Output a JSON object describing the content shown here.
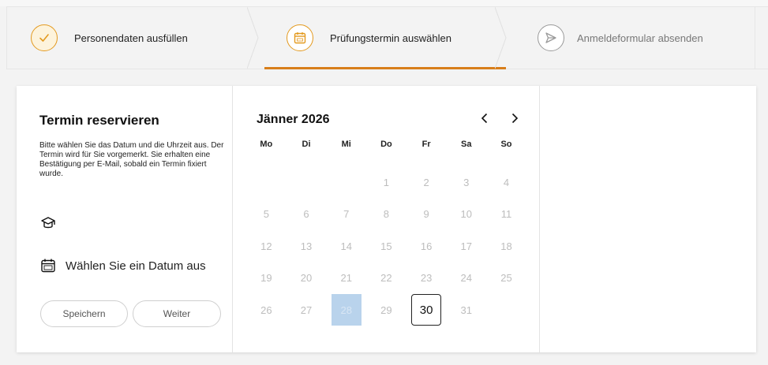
{
  "steps": [
    {
      "label": "Personendaten ausfüllen",
      "state": "done"
    },
    {
      "label": "Prüfungstermin auswählen",
      "state": "active"
    },
    {
      "label": "Anmeldeformular absenden",
      "state": "pending"
    }
  ],
  "reservation": {
    "title": "Termin reservieren",
    "description": "Bitte wählen Sie das Datum und die Uhrzeit aus. Der Termin wird für Sie vorgemerkt. Sie erhalten eine Bestätigung per E-Mail, sobald ein Termin fixiert wurde.",
    "exam_icon": "graduation-cap-icon",
    "date_prompt": "Wählen Sie ein Datum aus",
    "save_label": "Speichern",
    "next_label": "Weiter"
  },
  "calendar": {
    "month": "Jänner 2026",
    "weekdays": [
      "Mo",
      "Di",
      "Mi",
      "Do",
      "Fr",
      "Sa",
      "So"
    ],
    "leading_blanks": 3,
    "days": [
      "1",
      "2",
      "3",
      "4",
      "5",
      "6",
      "7",
      "8",
      "9",
      "10",
      "11",
      "12",
      "13",
      "14",
      "15",
      "16",
      "17",
      "18",
      "19",
      "20",
      "21",
      "22",
      "23",
      "24",
      "25",
      "26",
      "27",
      "28",
      "29",
      "30",
      "31"
    ],
    "selected_day": "28",
    "available_day": "30"
  },
  "colors": {
    "accent": "#e39a1f",
    "underline": "#d87e1a",
    "selected": "#b9d3ec"
  }
}
